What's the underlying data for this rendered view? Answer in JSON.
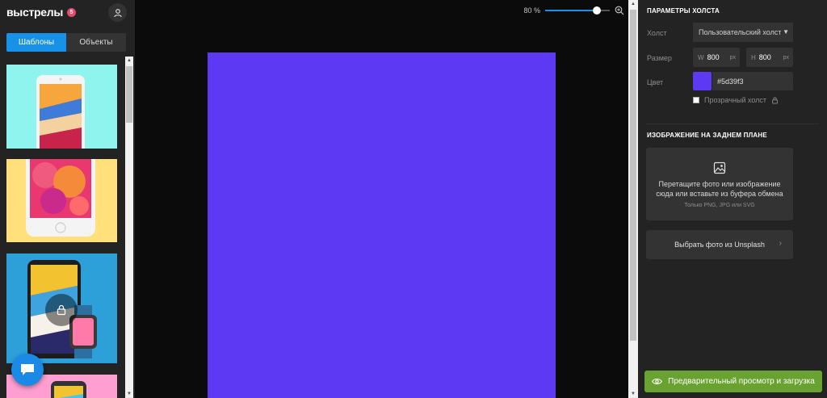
{
  "brand": {
    "name": "выстрелы",
    "badge_count": "5"
  },
  "icons": {
    "account": "user-icon",
    "zoom_in": "zoom-in-icon",
    "image": "image-icon",
    "lock": "lock-icon",
    "chevron": "chevron-right-icon",
    "eye": "eye-icon",
    "chat": "chat-icon",
    "caret": "caret-down-icon"
  },
  "sidebar": {
    "tabs": [
      {
        "label": "Шаблоны",
        "active": true
      },
      {
        "label": "Объекты",
        "active": false
      }
    ],
    "templates": [
      {
        "name": "iphone-on-cyan",
        "background": "#8ff3ee"
      },
      {
        "name": "iphone-on-yellow",
        "background": "#ffe07a"
      },
      {
        "name": "iphone-and-watch-on-blue",
        "background": "#2d9fd9",
        "locked": true
      },
      {
        "name": "iphone-on-pink",
        "background": "#ff9ed1"
      }
    ]
  },
  "zoom": {
    "label": "80 %",
    "level": 0.8
  },
  "canvas": {
    "color": "#5d39f3"
  },
  "panel": {
    "canvas_section_title": "ПАРАМЕТРЫ ХОЛСТА",
    "canvas_label": "Холст",
    "canvas_select_value": "Пользовательский холст",
    "size_label": "Размер",
    "width_prefix": "W",
    "width_value": "800",
    "height_prefix": "H",
    "height_value": "800",
    "unit": "px",
    "color_label": "Цвет",
    "color_hex": "#5d39f3",
    "transparent_label": "Прозрачный холст",
    "transparent_checked": false,
    "bg_section_title": "ИЗОБРАЖЕНИЕ НА ЗАДНЕМ ПЛАНЕ",
    "dropzone_line1": "Перетащите фото или изображение",
    "dropzone_line2": "сюда или вставьте из буфера обмена",
    "dropzone_formats": "Только PNG, JPG или SVG",
    "unsplash_button": "Выбрать фото из Unsplash",
    "preview_button": "Предварительный просмотр и загрузка"
  },
  "colors": {
    "accent_blue": "#1891e8",
    "preview_green": "#6aa232",
    "badge_red": "#e54b6c",
    "panel_bg": "#232323",
    "stage_bg": "#0b0b0b"
  }
}
